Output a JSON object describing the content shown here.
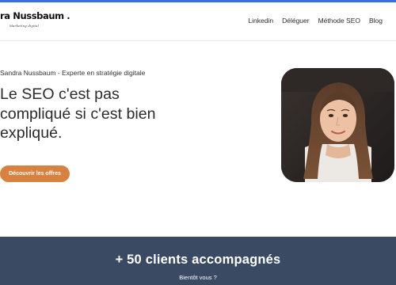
{
  "header": {
    "logo_name": "ra Nussbaum .",
    "logo_tagline": "Marketing digital",
    "nav": [
      {
        "label": "Linkedin"
      },
      {
        "label": "Déléguer"
      },
      {
        "label": "Méthode SEO"
      },
      {
        "label": "Blog"
      }
    ]
  },
  "hero": {
    "subtitle": "Sandra Nussbaum - Experte en stratégie digitale",
    "headline_lines": [
      "Le SEO c'est pas",
      "compliqué si c'est bien",
      "expliqué."
    ],
    "cta_label": "Découvrir les offres",
    "cta_color": "#d9823f"
  },
  "band": {
    "title": "+ 50 clients accompagnés",
    "subtitle": "Bientôt vous ?",
    "background": "#3a4a63"
  },
  "colors": {
    "top_accent": "#3b6fe0"
  }
}
